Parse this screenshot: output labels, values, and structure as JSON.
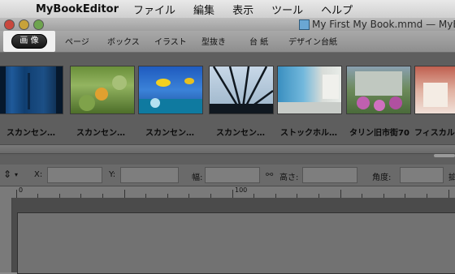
{
  "menubar": {
    "app_name": "MyBookEditor",
    "items": [
      "ファイル",
      "編集",
      "表示",
      "ツール",
      "ヘルプ"
    ]
  },
  "window": {
    "title": "My First My Book.mmd — MyBo"
  },
  "tabs": [
    {
      "label": "画 像",
      "active": true
    },
    {
      "label": "ページ"
    },
    {
      "label": "ボックス"
    },
    {
      "label": "イラスト"
    },
    {
      "label": "型抜き"
    },
    {
      "label": "台 紙"
    },
    {
      "label": "デザイン台紙"
    }
  ],
  "library": {
    "items": [
      {
        "caption": "スカンセン…"
      },
      {
        "caption": "スカンセン…"
      },
      {
        "caption": "スカンセン…"
      },
      {
        "caption": "スカンセン…"
      },
      {
        "caption": "ストックホル…"
      },
      {
        "caption": "タリン旧市街70"
      },
      {
        "caption": "フィスカル"
      }
    ]
  },
  "inspector": {
    "x_label": "X:",
    "y_label": "Y:",
    "width_label": "幅:",
    "height_label": "高さ:",
    "angle_label": "角度:",
    "extra_label": "拡"
  },
  "ruler": {
    "labels": [
      "0",
      "100"
    ]
  },
  "colors": {
    "active_tab_bg": "#1e1e1e",
    "aquarium_blue": "#1f5a9a"
  }
}
